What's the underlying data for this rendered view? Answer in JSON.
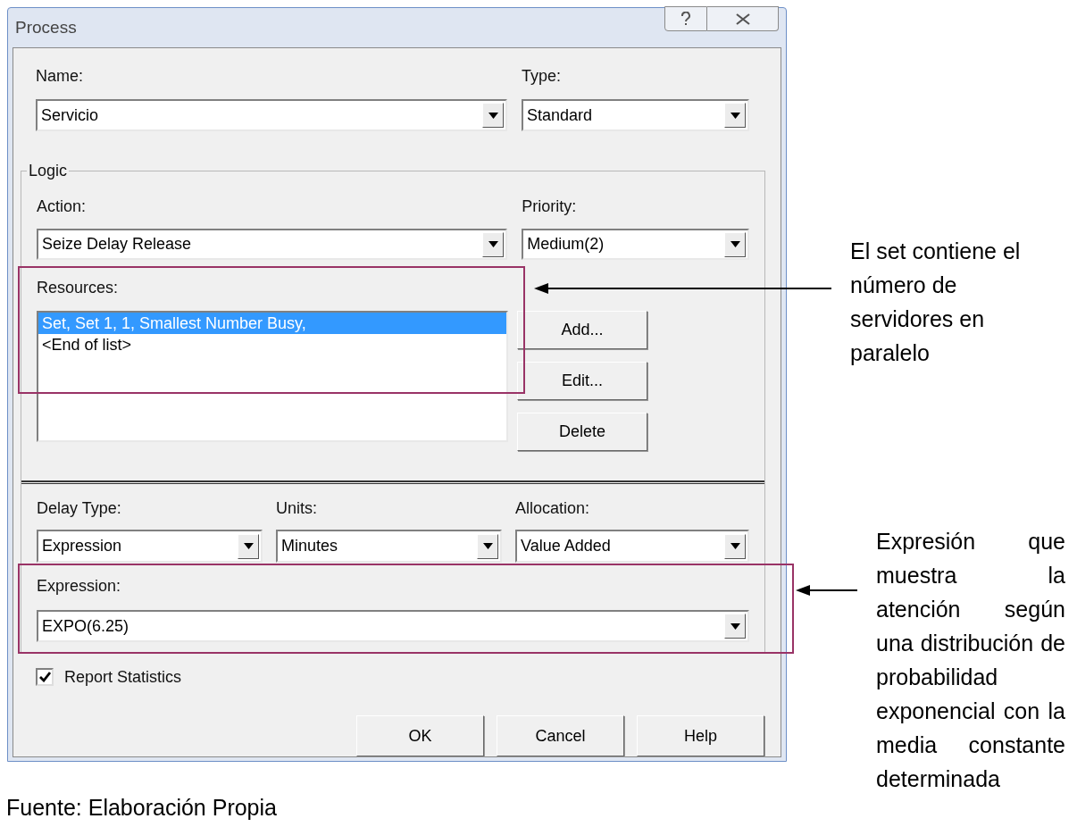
{
  "dialog": {
    "title": "Process"
  },
  "name": {
    "label": "Name:",
    "value": "Servicio"
  },
  "type": {
    "label": "Type:",
    "value": "Standard"
  },
  "logic": {
    "title": "Logic",
    "action": {
      "label": "Action:",
      "value": "Seize Delay Release"
    },
    "priority": {
      "label": "Priority:",
      "value": "Medium(2)"
    },
    "resources": {
      "label": "Resources:",
      "items": [
        {
          "text": "Set, Set 1, 1, Smallest Number Busy,",
          "selected": true
        },
        {
          "text": "<End of list>",
          "selected": false
        }
      ]
    },
    "resource_buttons": [
      "Add...",
      "Edit...",
      "Delete"
    ],
    "delay_type": {
      "label": "Delay Type:",
      "value": "Expression"
    },
    "units": {
      "label": "Units:",
      "value": "Minutes"
    },
    "allocation": {
      "label": "Allocation:",
      "value": "Value Added"
    },
    "expression": {
      "label": "Expression:",
      "value": "EXPO(6.25)"
    }
  },
  "report_statistics": {
    "label": "Report Statistics",
    "checked": true
  },
  "buttons": [
    "OK",
    "Cancel",
    "Help"
  ],
  "caption": "Fuente: Elaboración Propia",
  "annotations": [
    {
      "text": "El set contiene el número de servidores en paralelo"
    },
    {
      "text": "Expresión que muestra la atención según una distribución de probabilidad exponencial con la media constante determinada"
    }
  ]
}
